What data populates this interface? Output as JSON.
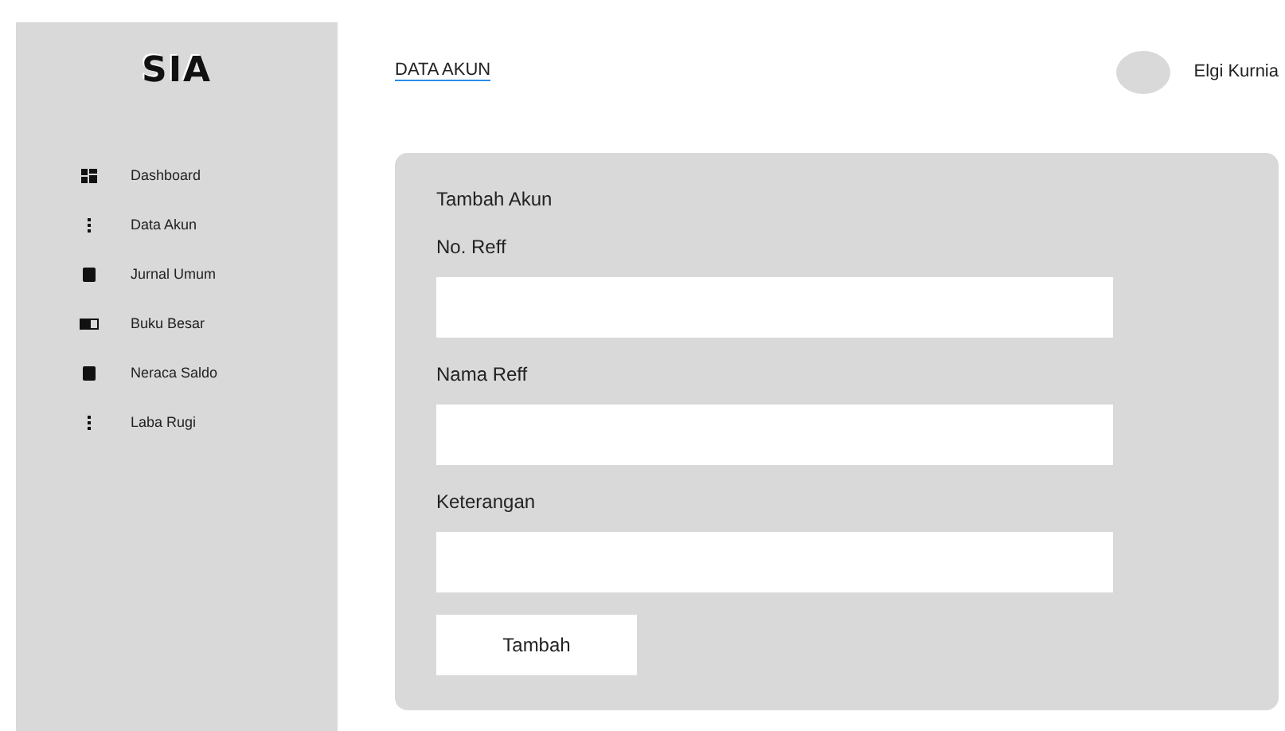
{
  "sidebar": {
    "logo": "SIA",
    "items": [
      {
        "label": "Dashboard",
        "kind": "grid"
      },
      {
        "label": "Data Akun",
        "kind": "dots"
      },
      {
        "label": "Jurnal Umum",
        "kind": "square"
      },
      {
        "label": "Buku Besar",
        "kind": "book"
      },
      {
        "label": "Neraca Saldo",
        "kind": "square"
      },
      {
        "label": "Laba Rugi",
        "kind": "dots"
      }
    ]
  },
  "header": {
    "title": "DATA AKUN",
    "user": "Elgi Kurnia"
  },
  "form": {
    "title": "Tambah Akun",
    "fields": [
      {
        "label": "No. Reff"
      },
      {
        "label": "Nama Reff"
      },
      {
        "label": "Keterangan"
      }
    ],
    "button": "Tambah"
  }
}
